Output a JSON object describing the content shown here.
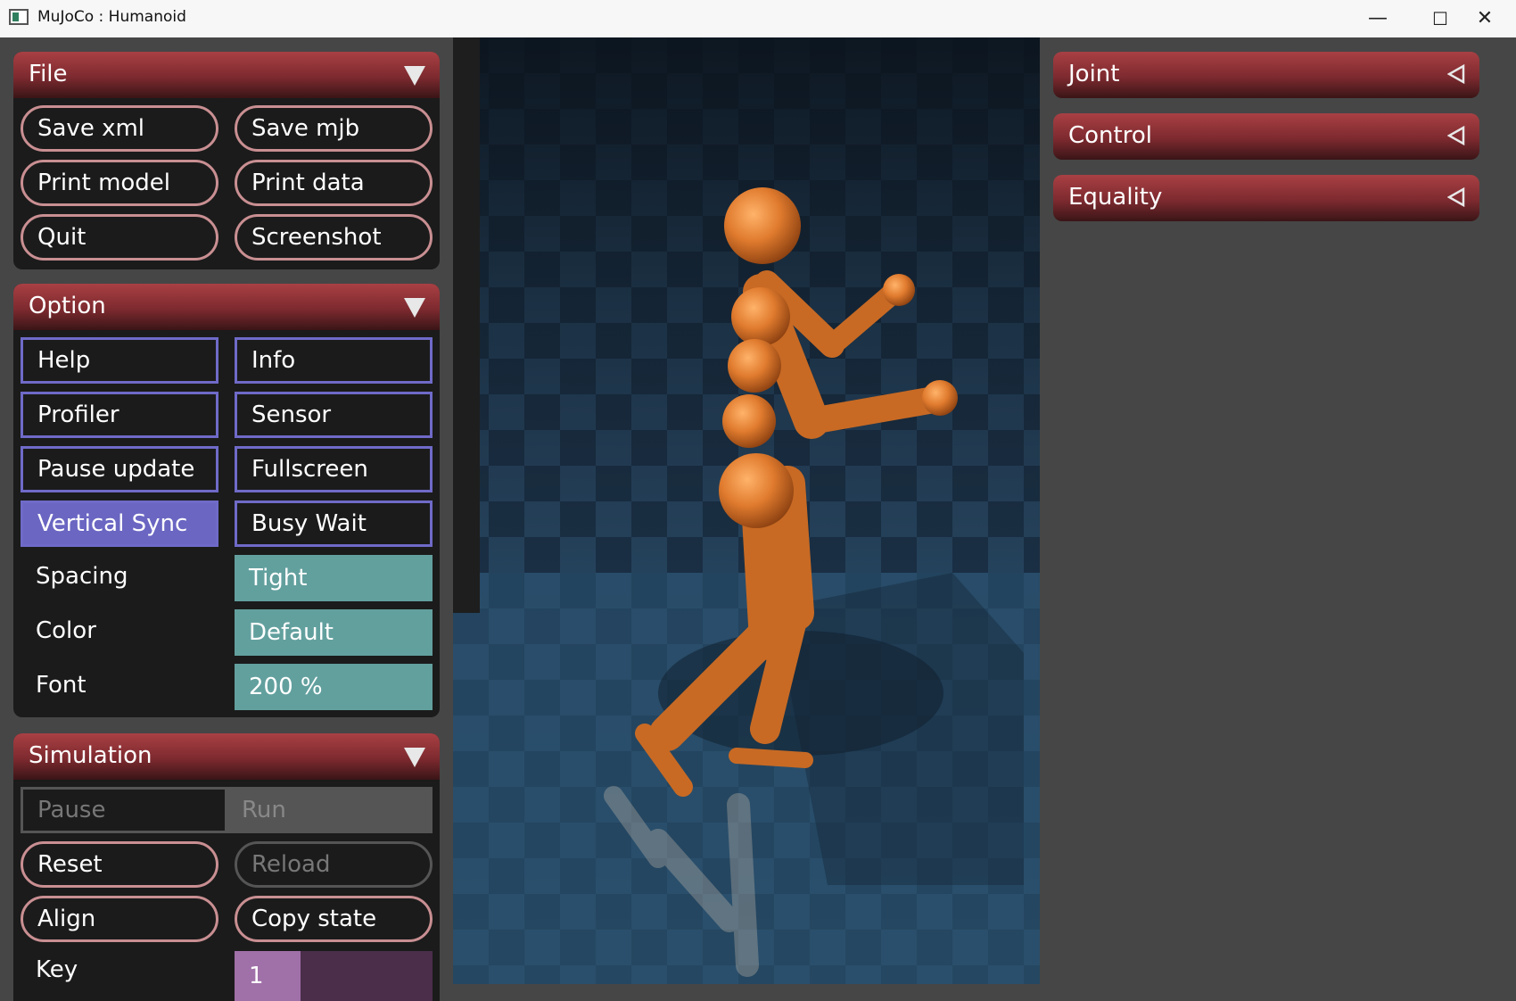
{
  "window": {
    "title": "MuJoCo : Humanoid",
    "controls": {
      "minimize": "—",
      "maximize": "☐",
      "close": "✕"
    }
  },
  "file": {
    "title": "File",
    "buttons": [
      "Save xml",
      "Save mjb",
      "Print model",
      "Print data",
      "Quit",
      "Screenshot"
    ]
  },
  "option": {
    "title": "Option",
    "toggles": [
      {
        "label": "Help",
        "on": false
      },
      {
        "label": "Info",
        "on": false
      },
      {
        "label": "Profiler",
        "on": false
      },
      {
        "label": "Sensor",
        "on": false
      },
      {
        "label": "Pause update",
        "on": false
      },
      {
        "label": "Fullscreen",
        "on": false
      },
      {
        "label": "Vertical Sync",
        "on": true
      },
      {
        "label": "Busy Wait",
        "on": false
      }
    ],
    "selects": [
      {
        "label": "Spacing",
        "value": "Tight"
      },
      {
        "label": "Color",
        "value": "Default"
      },
      {
        "label": "Font",
        "value": "200 %"
      }
    ]
  },
  "simulation": {
    "title": "Simulation",
    "radio": [
      "Pause",
      "Run"
    ],
    "buttons": [
      "Reset",
      "Reload",
      "Align",
      "Copy state"
    ],
    "key_label": "Key",
    "key_value": "1"
  },
  "right": {
    "sections": [
      "Joint",
      "Control",
      "Equality"
    ]
  },
  "colors": {
    "header_red": "#8e3237",
    "toggle_on": "#6a66c2",
    "select_bg": "#62a09e",
    "floor_blue": "#2b5575",
    "body_orange": "#e07b2e"
  }
}
